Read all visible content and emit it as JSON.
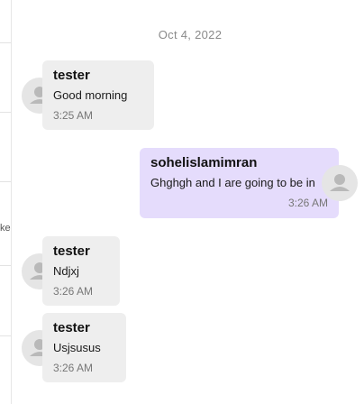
{
  "sidebar": {
    "truncated_label": "ke"
  },
  "conversation": {
    "date_separator": "Oct 4, 2022",
    "messages": [
      {
        "sender": "tester",
        "text": "Good morning",
        "time": "3:25 AM",
        "direction": "incoming"
      },
      {
        "sender": "sohelislamimran",
        "text": "Ghghgh and I are going to be in",
        "time": "3:26 AM",
        "direction": "outgoing"
      },
      {
        "sender": "tester",
        "text": "Ndjxj",
        "time": "3:26 AM",
        "direction": "incoming"
      },
      {
        "sender": "tester",
        "text": "Usjsusus",
        "time": "3:26 AM",
        "direction": "incoming"
      }
    ]
  },
  "icons": {
    "avatar": "user-avatar-icon"
  },
  "colors": {
    "incoming_bubble": "#eeeeee",
    "outgoing_bubble": "#e5dcfc",
    "avatar_bg": "#e5e5e5",
    "avatar_glyph": "#ffffff"
  }
}
